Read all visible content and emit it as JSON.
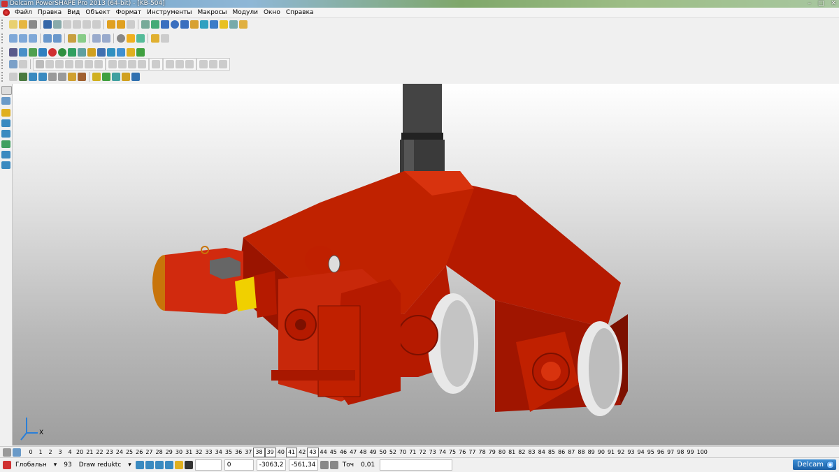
{
  "window": {
    "title": "Delcam PowerSHAPE Pro 2013 (64-bit) - [KB-504]",
    "minimize": "–",
    "maximize": "□",
    "close": "✕"
  },
  "menu": [
    "Файл",
    "Правка",
    "Вид",
    "Объект",
    "Формат",
    "Инструменты",
    "Макросы",
    "Модули",
    "Окно",
    "Справка"
  ],
  "levels": {
    "numbers": [
      "0",
      "1",
      "2",
      "3",
      "4",
      "20",
      "21",
      "22",
      "23",
      "24",
      "25",
      "26",
      "27",
      "28",
      "29",
      "30",
      "31",
      "32",
      "33",
      "34",
      "35",
      "36",
      "37",
      "38",
      "39",
      "40",
      "41",
      "42",
      "43",
      "44",
      "45",
      "46",
      "47",
      "48",
      "49",
      "50",
      "52",
      "70",
      "71",
      "72",
      "73",
      "74",
      "75",
      "76",
      "77",
      "78",
      "79",
      "80",
      "81",
      "82",
      "83",
      "84",
      "85",
      "86",
      "87",
      "88",
      "89",
      "90",
      "91",
      "92",
      "93",
      "94",
      "95",
      "96",
      "97",
      "98",
      "99",
      "100"
    ],
    "boxed": [
      "38",
      "39",
      "41",
      "43"
    ]
  },
  "status": {
    "workplane": "Глобальн",
    "level_number": "93",
    "level_name": "Draw reduktc",
    "coord_label": "0",
    "x": "-3063,2",
    "y": "-561,34",
    "tolerance_label": "Точ",
    "tolerance": "0,01",
    "brand": "Delcam"
  },
  "axes": {
    "x": "X"
  },
  "colors": {
    "model_red": "#b51a00",
    "model_red_light": "#d8330e",
    "model_red_dark": "#7c1000",
    "motor_orange": "#c8740a",
    "coupling_yellow": "#f0d000",
    "column_gray": "#3a3a3a",
    "wheel_white": "#e8e8e8"
  }
}
